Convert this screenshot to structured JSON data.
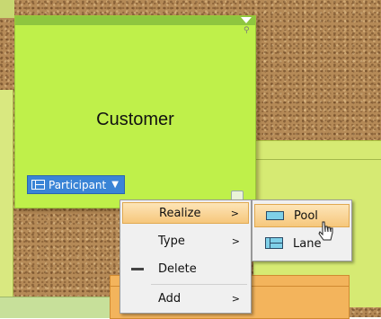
{
  "diagram": {
    "pool_name": "Customer",
    "participant_label": "Participant",
    "caret": "▼",
    "background_partial_text": "y"
  },
  "context_menu": {
    "items": [
      {
        "label": "Realize",
        "arrow": ">",
        "highlighted": true
      },
      {
        "label": "Type",
        "arrow": ">"
      },
      {
        "label": "Delete"
      },
      {
        "label": "Add",
        "arrow": ">"
      }
    ]
  },
  "realize_submenu": {
    "items": [
      {
        "label": "Pool",
        "icon": "pool-icon",
        "highlighted": true
      },
      {
        "label": "Lane",
        "icon": "lane-icon"
      }
    ]
  },
  "colors": {
    "pool_fill": "#bff04a",
    "pool_header": "#8ec63f",
    "participant_button": "#3a84d6",
    "menu_highlight": "#f6c77c"
  }
}
